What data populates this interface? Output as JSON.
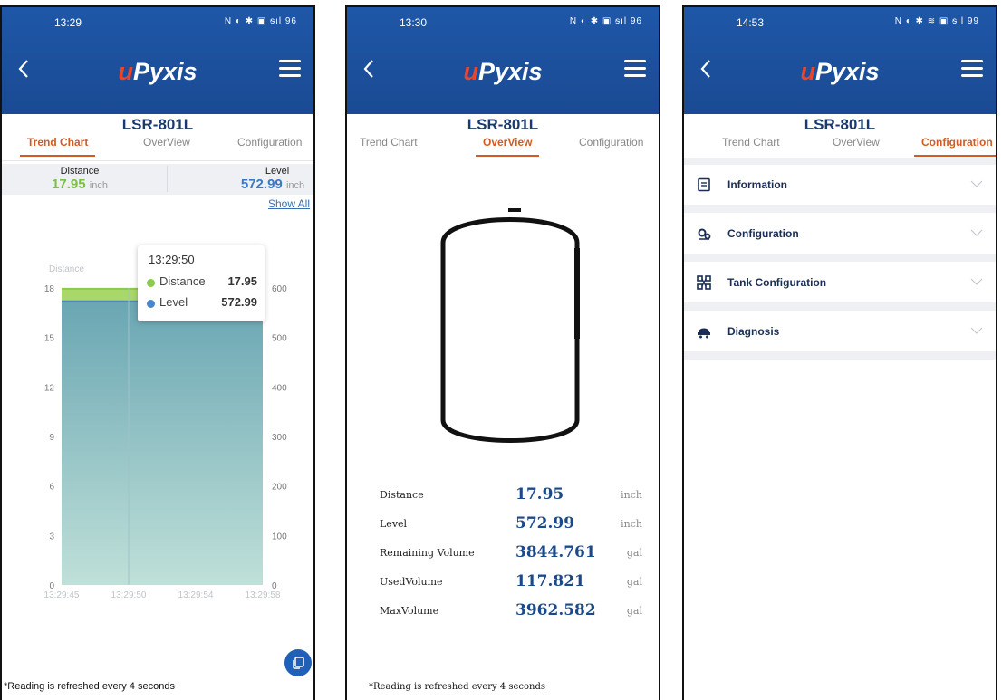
{
  "app": {
    "logo_u": "u",
    "logo_rest": "Pyxis",
    "device": "LSR-801L"
  },
  "tabs": {
    "trend": "Trend Chart",
    "overview": "OverView",
    "config": "Configuration"
  },
  "screens": [
    {
      "time": "13:29",
      "status": "N ◐ ✱ ▣ ᵴıl 96"
    },
    {
      "time": "13:30",
      "status": "N ◐ ✱ ▣ ᵴıl 96"
    },
    {
      "time": "14:53",
      "status": "N ◐ ✱ ≋ ▣ ᵴıl 99"
    }
  ],
  "trend": {
    "distance_label": "Distance",
    "distance_value": "17.95",
    "distance_unit": "inch",
    "level_label": "Level",
    "level_value": "572.99",
    "level_unit": "inch",
    "show_all": "Show All",
    "tooltip_time": "13:29:50",
    "tooltip_distance_name": "Distance",
    "tooltip_distance_value": "17.95",
    "tooltip_level_name": "Level",
    "tooltip_level_value": "572.99",
    "fab_icon": "copy-icon"
  },
  "chart_data": {
    "type": "area",
    "x": [
      "13:29:45",
      "13:29:50",
      "13:29:54",
      "13:29:58"
    ],
    "series": [
      {
        "name": "Distance",
        "axis": "left",
        "values": [
          17.95,
          17.95,
          17.95,
          17.95
        ],
        "color": "#a8d86a"
      },
      {
        "name": "Level",
        "axis": "right",
        "values": [
          572.99,
          572.99,
          572.99,
          572.99
        ],
        "color": "#4a86c8"
      }
    ],
    "left_axis": {
      "label": "Distance",
      "ticks": [
        "0",
        "3",
        "6",
        "9",
        "12",
        "15",
        "18"
      ],
      "range": [
        0,
        18
      ]
    },
    "right_axis": {
      "ticks": [
        "0",
        "100",
        "200",
        "300",
        "400",
        "500",
        "600"
      ],
      "range": [
        0,
        600
      ]
    },
    "grid": false
  },
  "overview": {
    "rows": [
      {
        "label": "Distance",
        "value": "17.95",
        "unit": "inch"
      },
      {
        "label": "Level",
        "value": "572.99",
        "unit": "inch"
      },
      {
        "label": "Remaining Volume",
        "value": "3844.761",
        "unit": "gal"
      },
      {
        "label": "UsedVolume",
        "value": "117.821",
        "unit": "gal"
      },
      {
        "label": "MaxVolume",
        "value": "3962.582",
        "unit": "gal"
      }
    ]
  },
  "config": {
    "sections": [
      {
        "title": "Information",
        "icon": "document-icon"
      },
      {
        "title": "Configuration",
        "icon": "gears-icon"
      },
      {
        "title": "Tank Configuration",
        "icon": "network-icon"
      },
      {
        "title": "Diagnosis",
        "icon": "diagnosis-icon"
      }
    ]
  },
  "footer_note": "*Reading is refreshed every 4 seconds"
}
